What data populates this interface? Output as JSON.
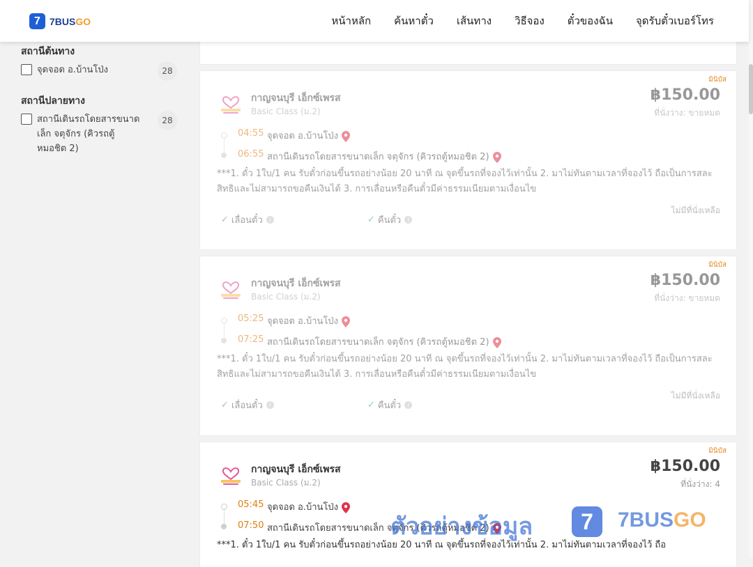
{
  "header": {
    "logo_mark": "7",
    "logo_text": "7BUS",
    "logo_text_accent": "GO",
    "nav": [
      "หน้าหลัก",
      "ค้นหาตั๋ว",
      "เส้นทาง",
      "วิธีจอง",
      "ตั๋วของฉัน",
      "จุดรับตั๋วเบอร์โทร"
    ]
  },
  "sidebar": {
    "origin_title": "สถานีต้นทาง",
    "origin_option": {
      "label": "จุดจอด อ.บ้านโป่ง",
      "count": "28"
    },
    "destination_title": "สถานีปลายทาง",
    "destination_option": {
      "label": "สถานีเดินรถโดยสารขนาดเล็ก จตุจักร (คิวรถตู้หมอชิต 2)",
      "count": "28"
    }
  },
  "trips": [
    {
      "badge": "มินิบัส",
      "operator": "กาญจนบุรี เอ็กซ์เพรส",
      "class": "Basic Class (ม.2)",
      "price": "฿150.00",
      "seats": "ที่นั่งว่าง: ขายหมด",
      "depart_time": "04:55",
      "depart_stop": "จุดจอด อ.บ้านโป่ง",
      "arrive_time": "06:55",
      "arrive_stop": "สถานีเดินรถโดยสารขนาดเล็ก จตุจักร (คิวรถตู้หมอชิต 2)",
      "desc": "***1. ตั๋ว 1ใบ/1 คน รับตั๋วก่อนขึ้นรถอย่างน้อย 20 นาที ณ จุดขึ้นรถที่จองไว้เท่านั้น 2. มาไม่ทันตามเวลาที่จองไว้ ถือเป็นการสละสิทธิและไม่สามารถขอคืนเงินได้ 3. การเลื่อนหรือคืนตั๋วมีค่าธรรมเนียมตามเงื่อนไข",
      "change": "เลื่อนตั๋ว",
      "refund": "คืนตั๋ว",
      "sold_note": "ไม่มีที่นั่งเหลือ"
    },
    {
      "badge": "มินิบัส",
      "operator": "กาญจนบุรี เอ็กซ์เพรส",
      "class": "Basic Class (ม.2)",
      "price": "฿150.00",
      "seats": "ที่นั่งว่าง: ขายหมด",
      "depart_time": "05:25",
      "depart_stop": "จุดจอด อ.บ้านโป่ง",
      "arrive_time": "07:25",
      "arrive_stop": "สถานีเดินรถโดยสารขนาดเล็ก จตุจักร (คิวรถตู้หมอชิต 2)",
      "desc": "***1. ตั๋ว 1ใบ/1 คน รับตั๋วก่อนขึ้นรถอย่างน้อย 20 นาที ณ จุดขึ้นรถที่จองไว้เท่านั้น 2. มาไม่ทันตามเวลาที่จองไว้ ถือเป็นการสละสิทธิและไม่สามารถขอคืนเงินได้ 3. การเลื่อนหรือคืนตั๋วมีค่าธรรมเนียมตามเงื่อนไข",
      "change": "เลื่อนตั๋ว",
      "refund": "คืนตั๋ว",
      "sold_note": "ไม่มีที่นั่งเหลือ"
    },
    {
      "badge": "มินิบัส",
      "operator": "กาญจนบุรี เอ็กซ์เพรส",
      "class": "Basic Class (ม.2)",
      "price": "฿150.00",
      "seats": "ที่นั่งว่าง: 4",
      "depart_time": "05:45",
      "depart_stop": "จุดจอด อ.บ้านโป่ง",
      "arrive_time": "07:50",
      "arrive_stop": "สถานีเดินรถโดยสารขนาดเล็ก จตุจักร (คิวรถตู้หมอชิต 2)",
      "desc": "***1. ตั๋ว 1ใบ/1 คน รับตั๋วก่อนขึ้นรถอย่างน้อย 20 นาที ณ จุดขึ้นรถที่จองไว้เท่านั้น 2. มาไม่ทันตามเวลาที่จองไว้ ถือ"
    }
  ],
  "watermark": {
    "text": "ตัวอย่างข้อมูล",
    "mark": "7",
    "brand": "7BUS",
    "brand_accent": "GO"
  },
  "colors": {
    "accent_orange": "#e07e12",
    "brand_blue": "#1f5fd6",
    "pin_red": "#e0334a",
    "check_green": "#3ea84a"
  }
}
